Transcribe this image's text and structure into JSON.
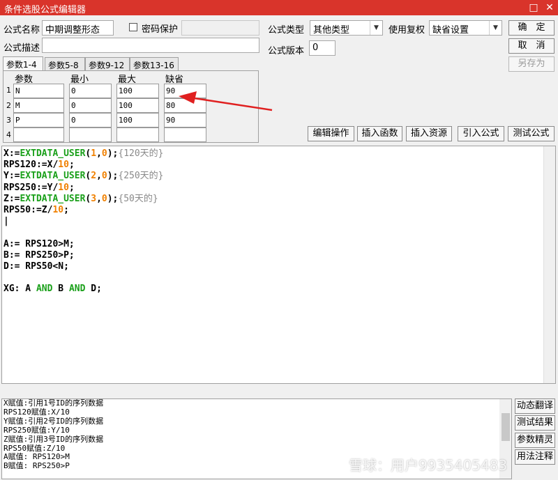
{
  "window": {
    "title": "条件选股公式编辑器",
    "restore_glyph": "□",
    "close_glyph": "✕"
  },
  "form": {
    "name_label": "公式名称",
    "name_value": "中期调整形态",
    "password_label": "密码保护",
    "desc_label": "公式描述",
    "desc_value": "",
    "type_label": "公式类型",
    "type_value": "其他类型",
    "rights_label": "使用复权",
    "rights_value": "缺省设置",
    "version_label": "公式版本",
    "version_value": "0"
  },
  "buttons": {
    "ok": "确　定",
    "cancel": "取　消",
    "save_as": "另存为"
  },
  "tabs": [
    "参数1-4",
    "参数5-8",
    "参数9-12",
    "参数13-16"
  ],
  "params": {
    "headers": [
      "参数",
      "最小",
      "最大",
      "缺省"
    ],
    "rows": [
      {
        "n": "1",
        "name": "N",
        "min": "0",
        "max": "100",
        "def": "90"
      },
      {
        "n": "2",
        "name": "M",
        "min": "0",
        "max": "100",
        "def": "80"
      },
      {
        "n": "3",
        "name": "P",
        "min": "0",
        "max": "100",
        "def": "90"
      },
      {
        "n": "4",
        "name": "",
        "min": "",
        "max": "",
        "def": ""
      }
    ]
  },
  "toolbar": [
    "编辑操作",
    "插入函数",
    "插入资源",
    "引入公式",
    "测试公式"
  ],
  "output_lines": [
    "X赋值:引用1号ID的序列数据",
    "RPS120赋值:X/10",
    "Y赋值:引用2号ID的序列数据",
    "RPS250赋值:Y/10",
    "Z赋值:引用3号ID的序列数据",
    "RPS50赋值:Z/10",
    "A赋值: RPS120>M",
    "B赋值: RPS250>P"
  ],
  "side_buttons": [
    "动态翻译",
    "测试结果",
    "参数精灵",
    "用法注释"
  ],
  "watermark": "雪球：用户9935405483",
  "colors": {
    "titlebar": "#d9342b",
    "keyword": "#1aa01a",
    "number": "#f08000",
    "comment": "#8a8a8a",
    "arrow": "#e02020"
  }
}
